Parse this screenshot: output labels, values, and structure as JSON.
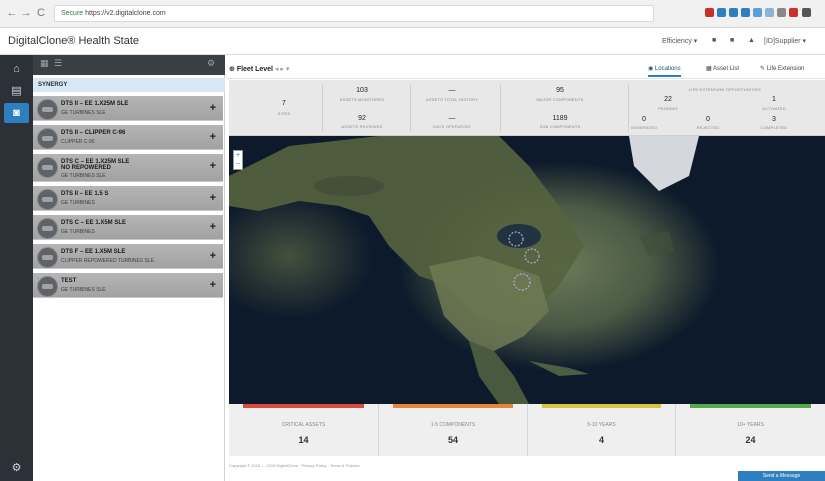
{
  "browser": {
    "back": "←",
    "forward": "→",
    "reload": "C",
    "secure_label": "Secure",
    "url": "https://v2.digitalclone.com"
  },
  "app": {
    "brand": "DigitalClone® Health State",
    "menu": [
      "Efficiency ▾",
      "■",
      "■",
      "▲",
      "[ID]Supplier ▾"
    ]
  },
  "rail": {
    "icons": [
      "home-icon",
      "database-icon",
      "camera-icon",
      "settings-icon"
    ]
  },
  "panel": {
    "toolbar_icons": [
      "grid-icon",
      "list-icon",
      "gear-icon"
    ],
    "group": "SYNERGY",
    "assets": [
      {
        "title": "DTS II – EE 1.X25M SLE",
        "sub": "GE TURBINES SLE",
        "plus": "+"
      },
      {
        "title": "DTS II – CLIPPER C-96",
        "sub": "CLIPPER C-96",
        "plus": "+"
      },
      {
        "title": "DTS C – EE 1.X25M SLE",
        "title2": "NO REPOWERED",
        "sub": "GE TURBINES SLE",
        "plus": "+"
      },
      {
        "title": "DTS II – EE 1.5 S",
        "sub": "GE TURBINES",
        "plus": "+"
      },
      {
        "title": "DTS C – EE 1.X5M SLE",
        "sub": "GE TURBINES",
        "plus": "+"
      },
      {
        "title": "DTS F – EE 1.X5M SLE",
        "sub": "CLIPPER REPOWERED TURBINES SLE",
        "plus": "+"
      },
      {
        "title": "TEST",
        "sub": "GE TURBINES SLE",
        "plus": "+"
      }
    ]
  },
  "main": {
    "fleet_tab": "Fleet Level",
    "right_tabs": [
      "Locations",
      "Asset List",
      "Life Extension"
    ],
    "kpis": {
      "sites": {
        "value": "7",
        "label": "Sites"
      },
      "assets_monitored": {
        "value": "103",
        "label": "Assets Monitored"
      },
      "assets_reviewed": {
        "value": "92",
        "label": "Assets Reviewed"
      },
      "assets_total": {
        "value": "—",
        "label": "Assets Total History"
      },
      "days_operating": {
        "value": "—",
        "label": "Days Operating"
      },
      "major_components": {
        "value": "95",
        "label": "Major Components"
      },
      "sub_components": {
        "value": "1189",
        "label": "Sub Components"
      },
      "life_ext_header": "Life Extension Opportunities",
      "pending": {
        "value": "22",
        "label": "Pending"
      },
      "activated": {
        "value": "1",
        "label": "Activated"
      },
      "generated": {
        "value": "0",
        "label": "Generated"
      },
      "rejected": {
        "value": "0",
        "label": "Rejected"
      },
      "completed": {
        "value": "3",
        "label": "Completed"
      }
    },
    "zoom": {
      "in": "+",
      "out": "−"
    },
    "severity": [
      {
        "label": "Critical Assets",
        "value": "14",
        "color": "#d94c3d"
      },
      {
        "label": "1-5 Components",
        "value": "54",
        "color": "#e9853a"
      },
      {
        "label": "5-10 Years",
        "value": "4",
        "color": "#d9c43c"
      },
      {
        "label": "10+ Years",
        "value": "24",
        "color": "#55a84b"
      }
    ],
    "footer": "Copyright © 2018 — 2019 DigitalClone · Privacy Policy · Terms & Policies",
    "message_button": "Send a Message"
  }
}
